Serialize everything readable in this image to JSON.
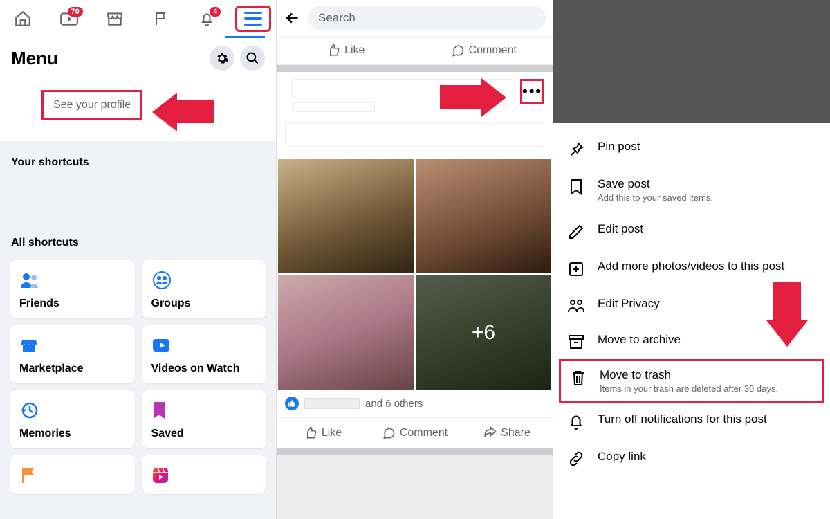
{
  "panel1": {
    "badges": {
      "watch": "70",
      "bell": "4"
    },
    "menu_title": "Menu",
    "profile_label": "See your profile",
    "shortcuts_label": "Your shortcuts",
    "all_shortcuts_label": "All shortcuts",
    "cards": {
      "friends": "Friends",
      "groups": "Groups",
      "marketplace": "Marketplace",
      "videos": "Videos on Watch",
      "memories": "Memories",
      "saved": "Saved"
    }
  },
  "panel2": {
    "search_placeholder": "Search",
    "like": "Like",
    "comment": "Comment",
    "share": "Share",
    "more_photos_overlay": "+6",
    "likes_suffix": "and 6 others"
  },
  "panel3": {
    "pin": "Pin post",
    "save": "Save post",
    "save_sub": "Add this to your saved items.",
    "edit": "Edit post",
    "add_media": "Add more photos/videos to this post",
    "privacy": "Edit Privacy",
    "archive": "Move to archive",
    "trash": "Move to trash",
    "trash_sub": "Items in your trash are deleted after 30 days.",
    "notif": "Turn off notifications for this post",
    "copy": "Copy link"
  }
}
